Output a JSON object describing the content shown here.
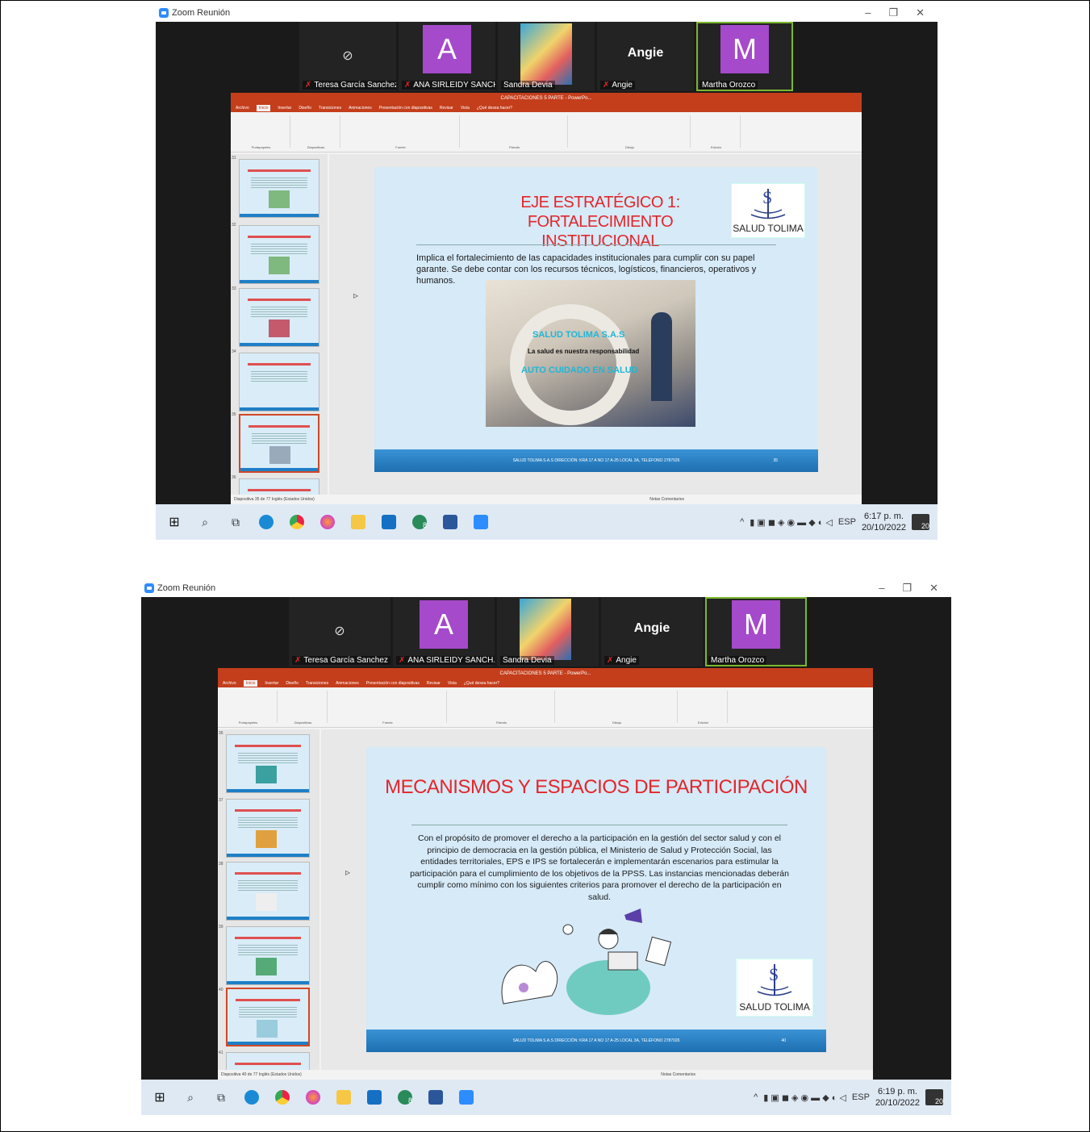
{
  "screenshots": [
    {
      "window_title": "Zoom Reunión",
      "participants": [
        {
          "name": "Teresa García Sanchez",
          "type": "camera-off"
        },
        {
          "name": "ANA SIRLEIDY SANCH...",
          "type": "avatar",
          "initial": "A"
        },
        {
          "name": "Sandra Devia",
          "type": "photo"
        },
        {
          "name": "Angie",
          "type": "name",
          "big_name": "Angie"
        },
        {
          "name": "Martha Orozco",
          "type": "avatar",
          "initial": "M",
          "active": true
        }
      ],
      "ppt_title": "CAPACITACIONES 5 PARTE - PowerPo...",
      "ppt_tabs": [
        "Archivo",
        "Inicio",
        "Insertar",
        "Diseño",
        "Transiciones",
        "Animaciones",
        "Presentación con diapositivas",
        "Revisar",
        "Vista",
        "¿Qué desea hacer?"
      ],
      "ribbon_groups": [
        "Portapapeles",
        "Diapositivas",
        "Fuente",
        "Párrafo",
        "Dibujo",
        "Edición"
      ],
      "thumb_numbers": [
        "31",
        "32",
        "33",
        "34",
        "35",
        "36"
      ],
      "selected_thumb_index": 4,
      "slide": {
        "title_line1": "EJE ESTRATÉGICO 1:",
        "title_line2": "FORTALECIMIENTO INSTITUCIONAL",
        "body": "Implica el fortalecimiento de las capacidades institucionales para cumplir con su papel garante. Se debe contar con los recursos técnicos, logísticos, financieros, operativos y humanos.",
        "photo_caption1": "SALUD TOLIMA S.A.S",
        "photo_caption2": "La salud es nuestra responsabilidad",
        "photo_caption3": "AUTO CUIDADO EN SALUD",
        "logo_text": "SALUD TOLIMA",
        "footer": "SALUD TOLIMA S.A.S DIRECCIÓN: KRA 17 A NO 17 A-25 LOCAL 3A, TELÉFONO 2787026",
        "number": "35"
      },
      "status_left": "Diapositiva 35 de 77   Inglés (Estados Unidos)",
      "status_right": "Notas   Comentarios",
      "clock_time": "6:17 p. m.",
      "clock_date": "20/10/2022",
      "lang": "ESP",
      "notif_count": "20",
      "outlook_badge": "8"
    },
    {
      "window_title": "Zoom Reunión",
      "participants": [
        {
          "name": "Teresa García Sanchez",
          "type": "camera-off"
        },
        {
          "name": "ANA SIRLEIDY SANCH...",
          "type": "avatar",
          "initial": "A"
        },
        {
          "name": "Sandra Devia",
          "type": "photo"
        },
        {
          "name": "Angie",
          "type": "name",
          "big_name": "Angie"
        },
        {
          "name": "Martha Orozco",
          "type": "avatar",
          "initial": "M",
          "active": true
        }
      ],
      "ppt_title": "CAPACITACIONES 5 PARTE - PowerPo...",
      "ppt_tabs": [
        "Archivo",
        "Inicio",
        "Insertar",
        "Diseño",
        "Transiciones",
        "Animaciones",
        "Presentación con diapositivas",
        "Revisar",
        "Vista",
        "¿Qué desea hacer?"
      ],
      "ribbon_groups": [
        "Portapapeles",
        "Diapositivas",
        "Fuente",
        "Párrafo",
        "Dibujo",
        "Edición"
      ],
      "thumb_numbers": [
        "36",
        "37",
        "38",
        "39",
        "40",
        "41"
      ],
      "selected_thumb_index": 4,
      "slide": {
        "title": "MECANISMOS Y ESPACIOS DE PARTICIPACIÓN",
        "body": "Con el propósito de promover el derecho a la participación en la gestión del sector salud y con el principio de democracia en la gestión pública, el Ministerio de Salud y Protección Social, las entidades territoriales, EPS e IPS se fortalecerán e implementarán escenarios para estimular la participación para el cumplimiento de los objetivos de la PPSS. Las instancias mencionadas deberán cumplir como mínimo con los siguientes criterios para promover el derecho de la participación en salud.",
        "logo_text": "SALUD TOLIMA",
        "footer": "SALUD TOLIMA S.A.S DIRECCIÓN: KRA 17 A NO 17 A-25 LOCAL 3A, TELÉFONO 2787026",
        "number": "40"
      },
      "status_left": "Diapositiva 40 de 77   Inglés (Estados Unidos)",
      "status_right": "Notas   Comentarios",
      "clock_time": "6:19 p. m.",
      "clock_date": "20/10/2022",
      "lang": "ESP",
      "notif_count": "20",
      "outlook_badge": "8"
    }
  ],
  "colors": {
    "zoom_bg": "#1a1a1a",
    "ppt_accent": "#c43e1c",
    "slide_bg": "#d6eaf8",
    "slide_title": "#e3262b",
    "footer_blue": "#1e6fb0",
    "avatar_purple": "#a54acb",
    "active_speaker": "#7bb82e"
  },
  "taskbar_icons": [
    "windows-start-icon",
    "search-icon",
    "task-view-icon",
    "edge-icon",
    "chrome-icon",
    "firefox-icon",
    "file-explorer-icon",
    "mail-icon",
    "outlook-icon",
    "word-icon",
    "zoom-icon"
  ]
}
